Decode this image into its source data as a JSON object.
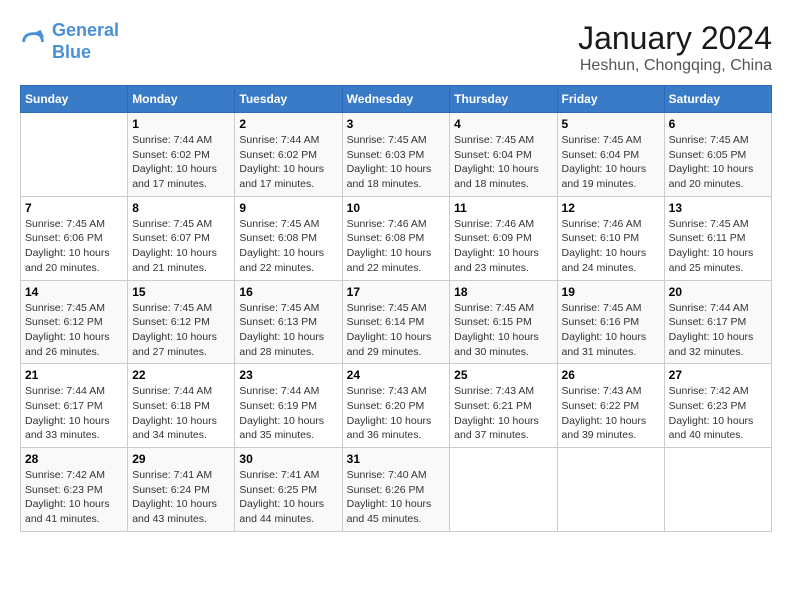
{
  "header": {
    "logo_line1": "General",
    "logo_line2": "Blue",
    "month_year": "January 2024",
    "location": "Heshun, Chongqing, China"
  },
  "days_of_week": [
    "Sunday",
    "Monday",
    "Tuesday",
    "Wednesday",
    "Thursday",
    "Friday",
    "Saturday"
  ],
  "weeks": [
    [
      {
        "day": "",
        "info": ""
      },
      {
        "day": "1",
        "info": "Sunrise: 7:44 AM\nSunset: 6:02 PM\nDaylight: 10 hours\nand 17 minutes."
      },
      {
        "day": "2",
        "info": "Sunrise: 7:44 AM\nSunset: 6:02 PM\nDaylight: 10 hours\nand 17 minutes."
      },
      {
        "day": "3",
        "info": "Sunrise: 7:45 AM\nSunset: 6:03 PM\nDaylight: 10 hours\nand 18 minutes."
      },
      {
        "day": "4",
        "info": "Sunrise: 7:45 AM\nSunset: 6:04 PM\nDaylight: 10 hours\nand 18 minutes."
      },
      {
        "day": "5",
        "info": "Sunrise: 7:45 AM\nSunset: 6:04 PM\nDaylight: 10 hours\nand 19 minutes."
      },
      {
        "day": "6",
        "info": "Sunrise: 7:45 AM\nSunset: 6:05 PM\nDaylight: 10 hours\nand 20 minutes."
      }
    ],
    [
      {
        "day": "7",
        "info": "Sunrise: 7:45 AM\nSunset: 6:06 PM\nDaylight: 10 hours\nand 20 minutes."
      },
      {
        "day": "8",
        "info": "Sunrise: 7:45 AM\nSunset: 6:07 PM\nDaylight: 10 hours\nand 21 minutes."
      },
      {
        "day": "9",
        "info": "Sunrise: 7:45 AM\nSunset: 6:08 PM\nDaylight: 10 hours\nand 22 minutes."
      },
      {
        "day": "10",
        "info": "Sunrise: 7:46 AM\nSunset: 6:08 PM\nDaylight: 10 hours\nand 22 minutes."
      },
      {
        "day": "11",
        "info": "Sunrise: 7:46 AM\nSunset: 6:09 PM\nDaylight: 10 hours\nand 23 minutes."
      },
      {
        "day": "12",
        "info": "Sunrise: 7:46 AM\nSunset: 6:10 PM\nDaylight: 10 hours\nand 24 minutes."
      },
      {
        "day": "13",
        "info": "Sunrise: 7:45 AM\nSunset: 6:11 PM\nDaylight: 10 hours\nand 25 minutes."
      }
    ],
    [
      {
        "day": "14",
        "info": "Sunrise: 7:45 AM\nSunset: 6:12 PM\nDaylight: 10 hours\nand 26 minutes."
      },
      {
        "day": "15",
        "info": "Sunrise: 7:45 AM\nSunset: 6:12 PM\nDaylight: 10 hours\nand 27 minutes."
      },
      {
        "day": "16",
        "info": "Sunrise: 7:45 AM\nSunset: 6:13 PM\nDaylight: 10 hours\nand 28 minutes."
      },
      {
        "day": "17",
        "info": "Sunrise: 7:45 AM\nSunset: 6:14 PM\nDaylight: 10 hours\nand 29 minutes."
      },
      {
        "day": "18",
        "info": "Sunrise: 7:45 AM\nSunset: 6:15 PM\nDaylight: 10 hours\nand 30 minutes."
      },
      {
        "day": "19",
        "info": "Sunrise: 7:45 AM\nSunset: 6:16 PM\nDaylight: 10 hours\nand 31 minutes."
      },
      {
        "day": "20",
        "info": "Sunrise: 7:44 AM\nSunset: 6:17 PM\nDaylight: 10 hours\nand 32 minutes."
      }
    ],
    [
      {
        "day": "21",
        "info": "Sunrise: 7:44 AM\nSunset: 6:17 PM\nDaylight: 10 hours\nand 33 minutes."
      },
      {
        "day": "22",
        "info": "Sunrise: 7:44 AM\nSunset: 6:18 PM\nDaylight: 10 hours\nand 34 minutes."
      },
      {
        "day": "23",
        "info": "Sunrise: 7:44 AM\nSunset: 6:19 PM\nDaylight: 10 hours\nand 35 minutes."
      },
      {
        "day": "24",
        "info": "Sunrise: 7:43 AM\nSunset: 6:20 PM\nDaylight: 10 hours\nand 36 minutes."
      },
      {
        "day": "25",
        "info": "Sunrise: 7:43 AM\nSunset: 6:21 PM\nDaylight: 10 hours\nand 37 minutes."
      },
      {
        "day": "26",
        "info": "Sunrise: 7:43 AM\nSunset: 6:22 PM\nDaylight: 10 hours\nand 39 minutes."
      },
      {
        "day": "27",
        "info": "Sunrise: 7:42 AM\nSunset: 6:23 PM\nDaylight: 10 hours\nand 40 minutes."
      }
    ],
    [
      {
        "day": "28",
        "info": "Sunrise: 7:42 AM\nSunset: 6:23 PM\nDaylight: 10 hours\nand 41 minutes."
      },
      {
        "day": "29",
        "info": "Sunrise: 7:41 AM\nSunset: 6:24 PM\nDaylight: 10 hours\nand 43 minutes."
      },
      {
        "day": "30",
        "info": "Sunrise: 7:41 AM\nSunset: 6:25 PM\nDaylight: 10 hours\nand 44 minutes."
      },
      {
        "day": "31",
        "info": "Sunrise: 7:40 AM\nSunset: 6:26 PM\nDaylight: 10 hours\nand 45 minutes."
      },
      {
        "day": "",
        "info": ""
      },
      {
        "day": "",
        "info": ""
      },
      {
        "day": "",
        "info": ""
      }
    ]
  ]
}
